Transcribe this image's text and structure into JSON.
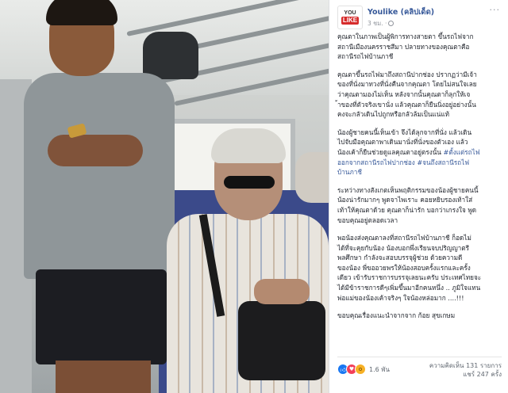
{
  "post": {
    "avatar": {
      "top": "YOU",
      "bottom": "LIKE"
    },
    "page_name": "Youlike (คลิปเด็ด)",
    "time": "3 ชม. ·",
    "paragraphs": [
      "คุณตาในภาพเป็นผู้พิการทางสายตา ขึ้นรถไฟจาก\nสถานีเมืองนครราชสีมา ปลายทางของคุณตาคือ\nสถานีรถไฟบ้านภาชี",
      "คุณตาขึ้นรถไฟมาถึงสถานีปากช่อง ปรากฏว่ามีเจ้า\nของที่นั่งมาทวงที่นั่งคืนจากคุณตา โดยไม่สนใจเลย\nว่าคุณตามองไม่เห็น หลังจากนั้นคุณตาก็ลุกให้เจ\n้าของที่ตัวจริงเขานั่ง แล้วคุณตาก็ยืนนิ่งอยู่อย่างนั้น\nคงจะกลัวเดินไปถูกหรือกลัวล้มเป็นแน่แท้",
      "น้องผู้ชายคนนี้เห็นเข้า จึงได้ลุกจากที่นั่ง แล้วเดิน\nไปจับมือคุณตาพาเดินมานั่งที่นั่งของตัวเอง แล้ว\nน้องเค้าก็ยืนช่วยดูแลคุณตาอยู่ตรงนั้น ",
      "ระหว่างทางสังเกตเห็นพฤติกรรมของน้องผู้ชายคนนี้\nน้องน่ารักมากๆ พูดจาไพเราะ คอยหยิบรองเท้าใส่\nเท้าให้คุณตาด้วย คุณตาก็น่ารัก บอกว่าเกรงใจ พูด\nขอบคุณอยู่ตลอดเวลา",
      "พอน้องส่งคุณตาลงที่สถานีรถไฟบ้านภาชี ก็อดไม่\nได้ที่จะคุยกับน้อง น้องบอกพึ่งเรียนจบปริญญาตรี\nพลศึกษา กำลังจะสอบบรรจุผู้ช่วย ด้วยความดี\nของน้อง พี่ขออวยพรให้น้องสอบครั้งแรกและครั้ง\nเดียว เข้ารับราชการบรรจุเลยนะครับ ประเทศไทยจะ\nได้มีข้าราชการดีๆเพิ่มขึ้นมาอีกคนหนึ่ง .. ภูมิใจแทน\nพ่อแม่ของน้องเค้าจริงๆ ใจน้องหล่อมาก ....!!!",
      "ขอบคุณเรื่องแนะนำจากจาก ก้อย สุขเกษม"
    ],
    "hashtag_line": "#ตั้งแต่รถไฟ\nออกจากสถานีรถไฟปากช่อง #จนถึงสถานีรถไฟ\nบ้านภาชี",
    "reaction_count": "1.6 พัน",
    "comments": "ความคิดเห็น 131 รายการ",
    "shares": "แชร์ 247 ครั้ง",
    "more_label": "···"
  }
}
